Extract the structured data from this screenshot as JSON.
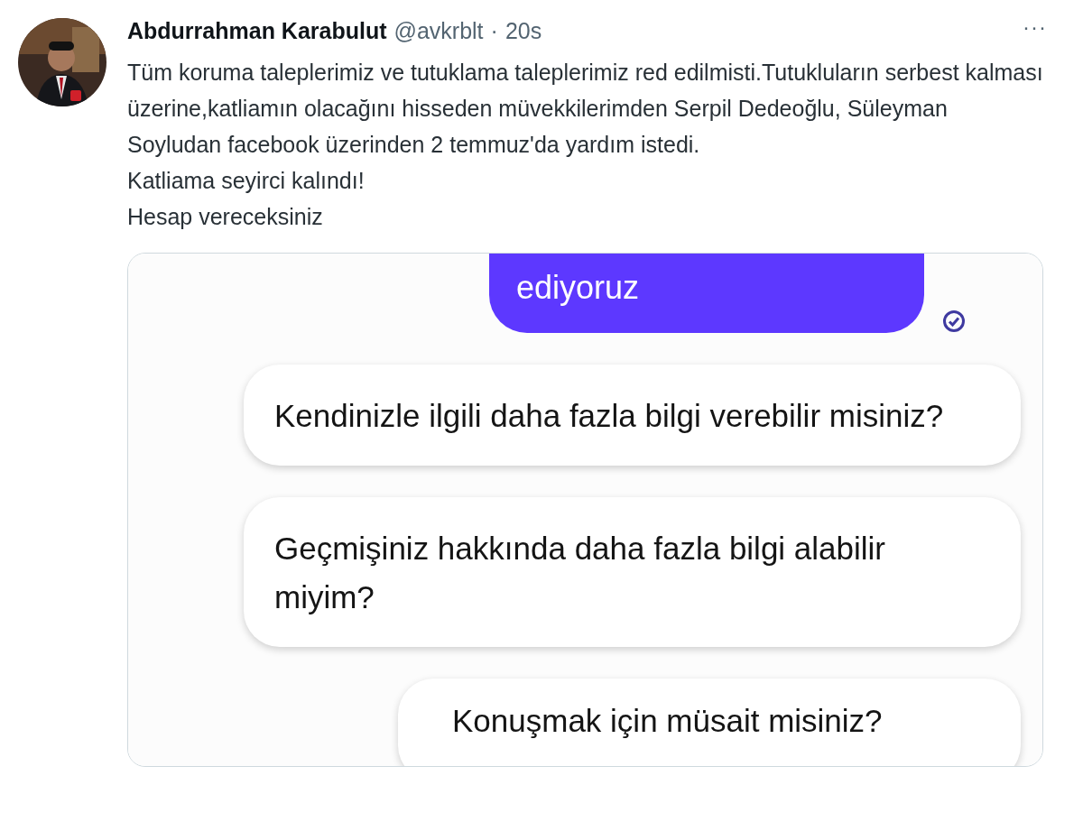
{
  "tweet": {
    "author": "Abdurrahman Karabulut",
    "handle": "@avkrblt",
    "separator": "·",
    "time": "20s",
    "more": "···",
    "paragraphs": [
      "Tüm koruma taleplerimiz ve tutuklama taleplerimiz red edilmisti.Tutukluların serbest kalması üzerine,katliamın olacağını hisseden müvekkilerimden Serpil Dedeoğlu, Süleyman Soyludan facebook üzerinden 2 temmuz'da yardım istedi.",
      "Katliama seyirci kalındı!",
      "Hesap vereceksiniz"
    ]
  },
  "media": {
    "messages": [
      {
        "kind": "sent",
        "text": "ediyoruz"
      },
      {
        "kind": "received",
        "text": "Kendinizle ilgili daha fazla bilgi verebilir misiniz?"
      },
      {
        "kind": "received",
        "text": "Geçmişiniz hakkında daha fazla bilgi alabilir miyim?"
      },
      {
        "kind": "received",
        "text": "Konuşmak için müsait misiniz?"
      }
    ]
  }
}
